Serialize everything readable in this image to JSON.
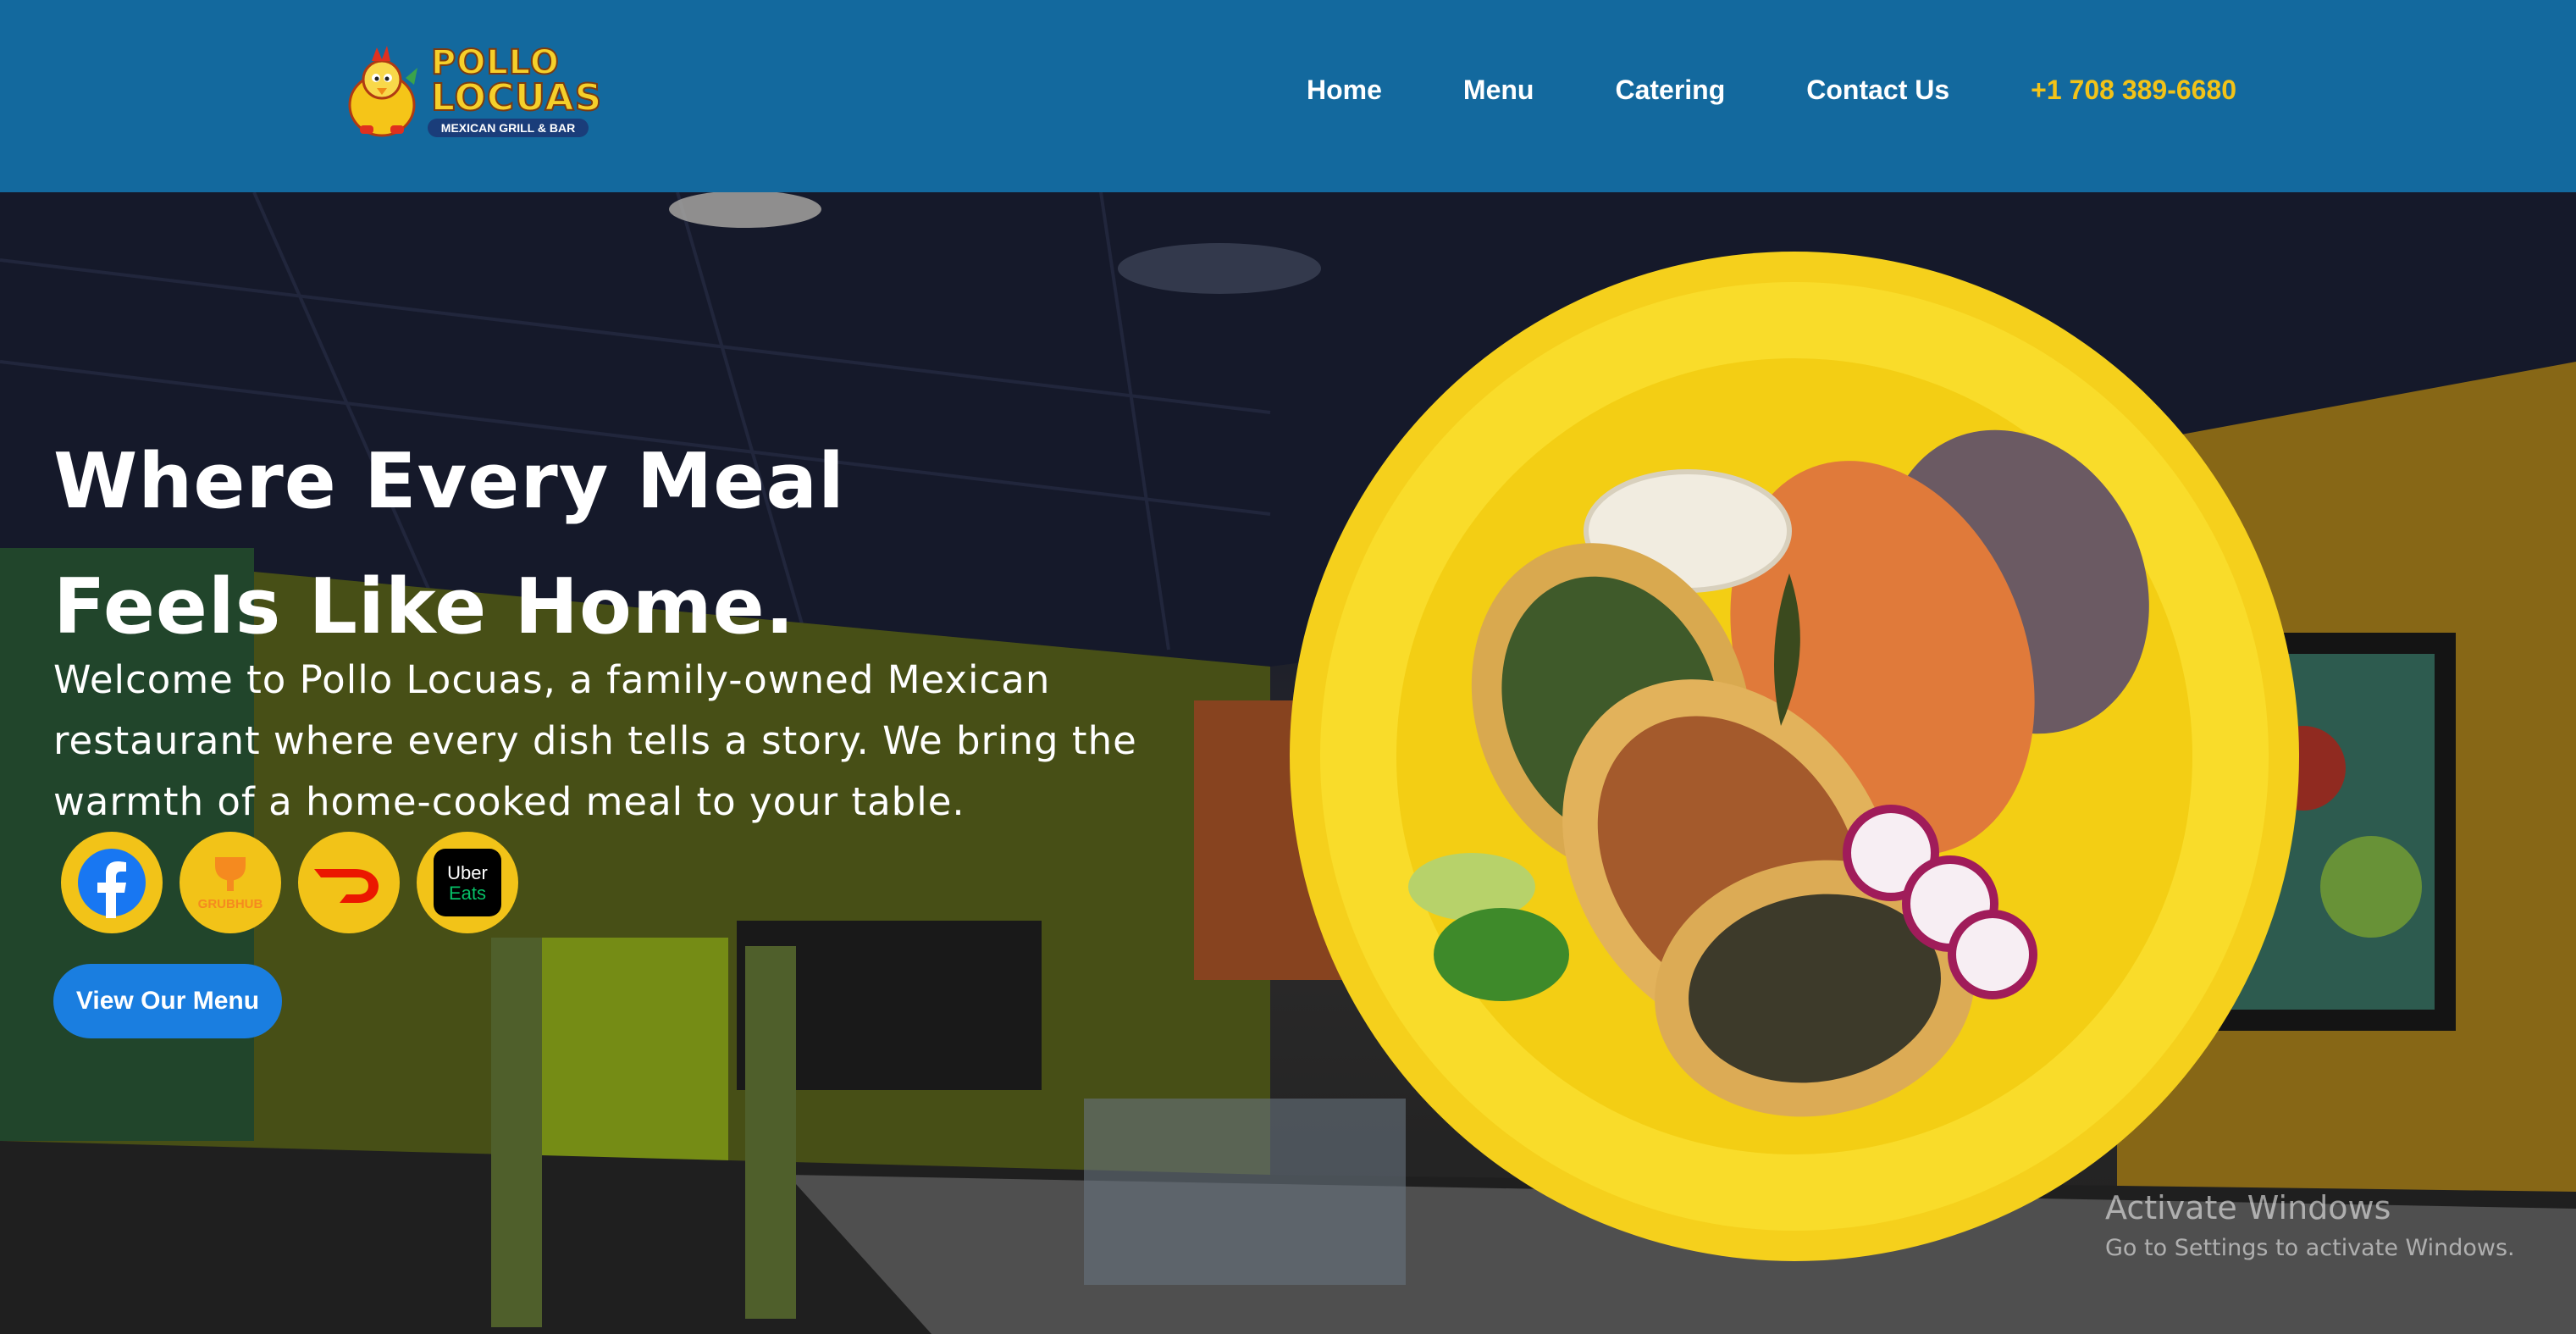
{
  "header": {
    "logo": {
      "line1": "POLLO",
      "line2": "LOCUAS",
      "tagline": "MEXICAN GRILL & BAR"
    },
    "nav": [
      {
        "label": "Home"
      },
      {
        "label": "Menu"
      },
      {
        "label": "Catering"
      },
      {
        "label": "Contact Us"
      }
    ],
    "phone": "+1 708 389-6680"
  },
  "hero": {
    "title_line1": "Where Every Meal",
    "title_line2": "Feels Like Home.",
    "description": "Welcome to Pollo Locuas, a family-owned Mexican restaurant where every dish tells a story. We bring the warmth of a home-cooked meal to your table.",
    "social_links": [
      {
        "name": "facebook-icon"
      },
      {
        "name": "grubhub-icon",
        "label": "GRUBHUB"
      },
      {
        "name": "doordash-icon"
      },
      {
        "name": "uber-eats-icon",
        "label_top": "Uber",
        "label_bottom": "Eats"
      }
    ],
    "cta_label": "View Our Menu"
  },
  "watermark": {
    "title": "Activate Windows",
    "subtitle": "Go to Settings to activate Windows."
  },
  "colors": {
    "header_bg": "#13699e",
    "phone": "#f2c318",
    "accent_yellow": "#f2c318",
    "cta_blue": "#1a7ee0"
  }
}
